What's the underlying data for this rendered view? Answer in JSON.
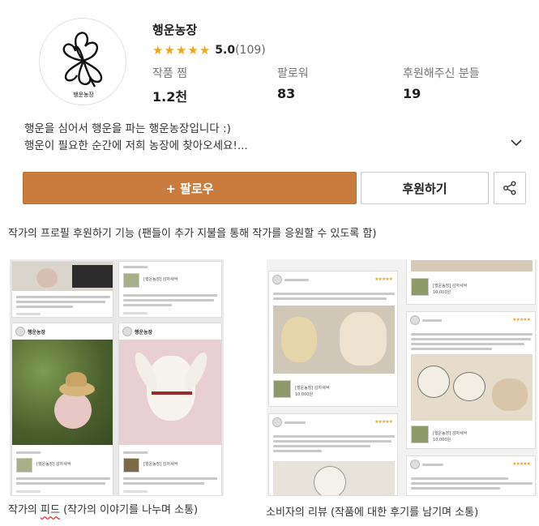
{
  "shop": {
    "name": "행운농장",
    "logo_text": "행운농장",
    "rating": "5.0",
    "review_count": "(109)",
    "stars": [
      "★",
      "★",
      "★",
      "★",
      "★"
    ]
  },
  "stats": [
    {
      "label": "작품 찜",
      "value": "1.2천"
    },
    {
      "label": "팔로워",
      "value": "83"
    },
    {
      "label": "후원해주신 분들",
      "value": "19"
    }
  ],
  "description": {
    "line1": "행운을 심어서 행운을 파는 행운농장입니다 :)",
    "line2": "행운이 필요한 순간에 저희 농장에 찾아오세요!..."
  },
  "buttons": {
    "follow": "+ 팔로우",
    "support": "후원하기"
  },
  "captions": {
    "top": "작가의 프로필 후원하기 기능 (팬들이 추가 지불을 통해 작가를 응원할 수 있도록 함)",
    "left_a": "작가의 ",
    "left_b": "피드",
    "left_c": " (작가의 이야기를 나누며 소통)",
    "right": "소비자의 리뷰 (작품에 대한 후기를 남기며 소통)"
  },
  "feed": {
    "author": "행운농장",
    "product": "[행운농장] 감자새싹"
  },
  "reviews": {
    "product": "[행운농장] 감자새싹",
    "price": "10,000원",
    "stars": "★★★★★"
  },
  "colors": {
    "accent": "#c97c3d",
    "star": "#f0a81a"
  },
  "icons": {
    "share": "share-icon",
    "chevron": "chevron-down-icon",
    "logo": "clover-logo"
  }
}
